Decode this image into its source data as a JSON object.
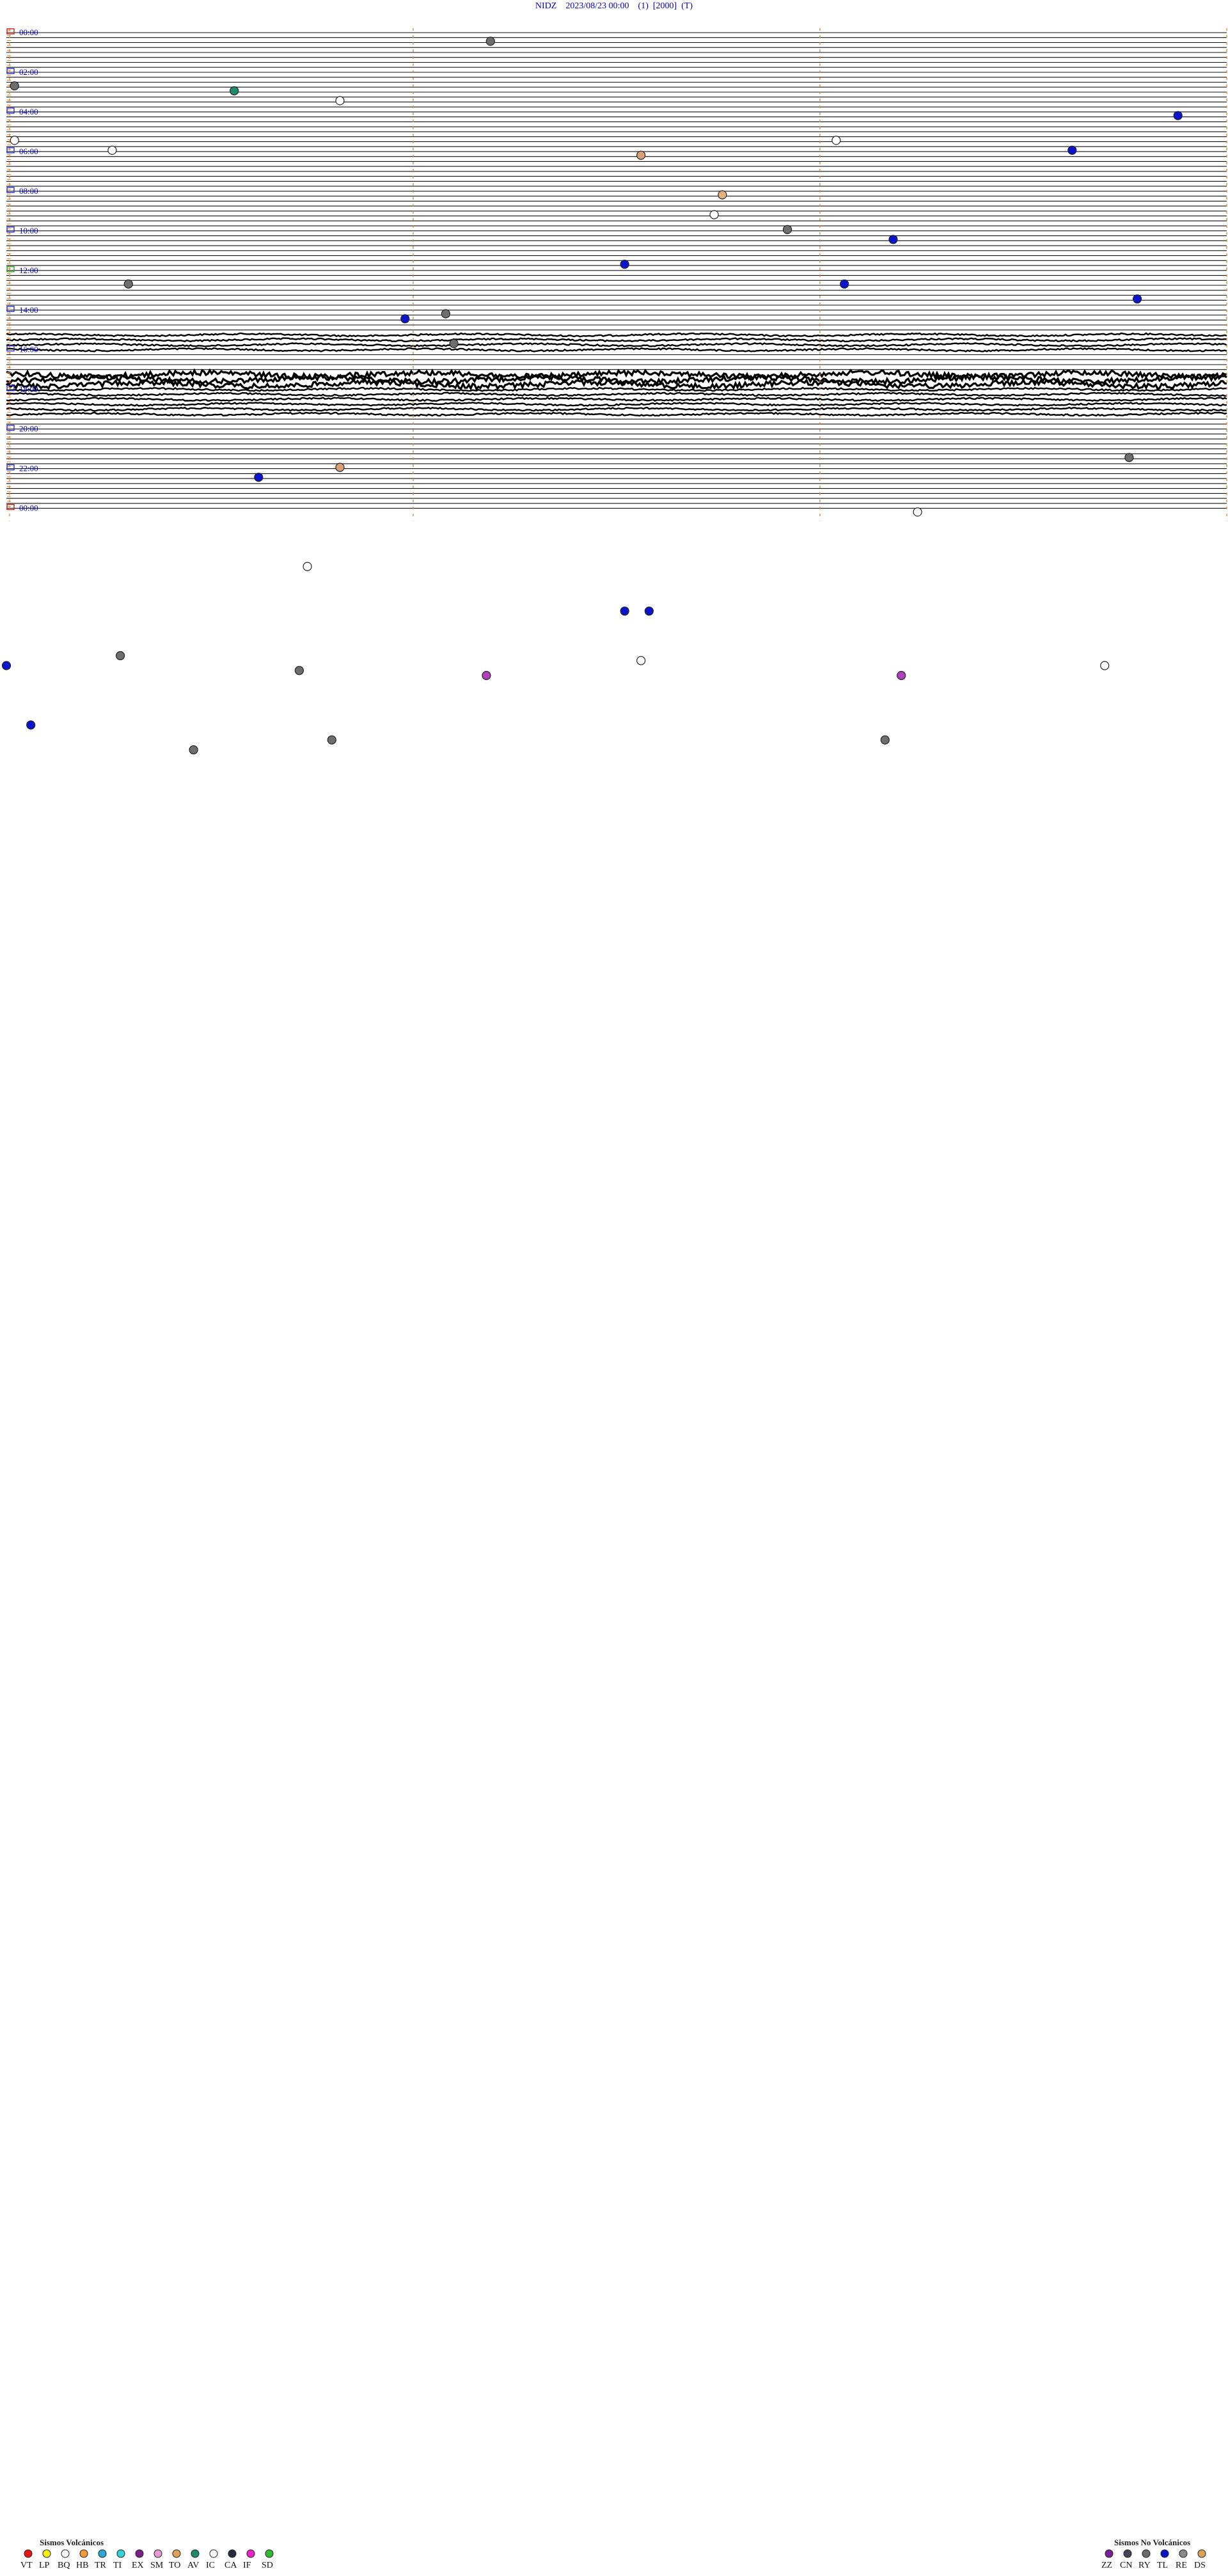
{
  "header": {
    "station": "NIDZ",
    "datetime": "2023/08/23 00:00",
    "field1": "(1)",
    "field2": "[2000]",
    "field3": "(T)"
  },
  "chart_data": {
    "type": "scatter",
    "lines_per_hour": 4,
    "hours": 24,
    "x_range": [
      0,
      15
    ],
    "x_unit": "minutes",
    "hour_labels": [
      "00:00",
      "02:00",
      "04:00",
      "06:00",
      "08:00",
      "10:00",
      "12:00",
      "14:00",
      "16:00",
      "18:00",
      "20:00",
      "22:00",
      "00:00"
    ],
    "busy_lines": [
      {
        "from": 61,
        "to": 64,
        "style": "wavy"
      },
      {
        "from": 69,
        "to": 71,
        "style": "band"
      },
      {
        "from": 72,
        "to": 77,
        "style": "wavy"
      }
    ],
    "events": [
      {
        "line": 2,
        "minute": 5.95,
        "type": "CA"
      },
      {
        "line": 11,
        "minute": 15.1,
        "type": "CA"
      },
      {
        "line": 12,
        "minute": 17.8,
        "type": "AV"
      },
      {
        "line": 14,
        "minute": 19.1,
        "type": "IC"
      },
      {
        "line": 17,
        "minute": 14.4,
        "type": "TL"
      },
      {
        "line": 22,
        "minute": 0.1,
        "type": "IC"
      },
      {
        "line": 22,
        "minute": 10.2,
        "type": "IC"
      },
      {
        "line": 24,
        "minute": 13.1,
        "type": "TL"
      },
      {
        "line": 24,
        "minute": 16.3,
        "type": "IC"
      },
      {
        "line": 25,
        "minute": 7.8,
        "type": "HB"
      },
      {
        "line": 33,
        "minute": 23.8,
        "type": "TO"
      },
      {
        "line": 37,
        "minute": 8.7,
        "type": "IC"
      },
      {
        "line": 40,
        "minute": 24.6,
        "type": "CA"
      },
      {
        "line": 42,
        "minute": 10.9,
        "type": "TL"
      },
      {
        "line": 47,
        "minute": 22.6,
        "type": "TL"
      },
      {
        "line": 51,
        "minute": 1.5,
        "type": "CA"
      },
      {
        "line": 51,
        "minute": 10.3,
        "type": "TL"
      },
      {
        "line": 54,
        "minute": 13.9,
        "type": "TL"
      },
      {
        "line": 57,
        "minute": 5.4,
        "type": "CA"
      },
      {
        "line": 58,
        "minute": 4.9,
        "type": "TL"
      },
      {
        "line": 63,
        "minute": 20.5,
        "type": "CA"
      },
      {
        "line": 86,
        "minute": 13.8,
        "type": "CA"
      },
      {
        "line": 88,
        "minute": 19.1,
        "type": "HB"
      },
      {
        "line": 90,
        "minute": 18.1,
        "type": "TL"
      },
      {
        "line": 97,
        "minute": 11.2,
        "type": "IC"
      },
      {
        "line": 108,
        "minute": 3.7,
        "type": "IC"
      },
      {
        "line": 117,
        "minute": 7.6,
        "type": "TL"
      },
      {
        "line": 117,
        "minute": 7.9,
        "type": "TL"
      },
      {
        "line": 126,
        "minute": 16.4,
        "type": "CA"
      },
      {
        "line": 127,
        "minute": 22.8,
        "type": "IC"
      },
      {
        "line": 128,
        "minute": 13.5,
        "type": "IC"
      },
      {
        "line": 128,
        "minute": 0.0,
        "type": "TL"
      },
      {
        "line": 129,
        "minute": 3.6,
        "type": "CA"
      },
      {
        "line": 130,
        "minute": 20.9,
        "type": "SM"
      },
      {
        "line": 130,
        "minute": 26.0,
        "type": "SM"
      },
      {
        "line": 140,
        "minute": 15.3,
        "type": "TL"
      },
      {
        "line": 143,
        "minute": 4.0,
        "type": "CA"
      },
      {
        "line": 143,
        "minute": 25.8,
        "type": "CA"
      },
      {
        "line": 145,
        "minute": 17.3,
        "type": "CA"
      }
    ]
  },
  "legend_volcanic": {
    "title": "Sismos Volcánicos",
    "codes": [
      "VT",
      "LP",
      "BQ",
      "HB",
      "TR",
      "TI",
      "EX",
      "SM",
      "TO",
      "AV",
      "IC",
      "CA",
      "IF",
      "SD"
    ],
    "colors": [
      "#e81515",
      "#f7f012",
      "#ffffff",
      "#f49a38",
      "#2aa9d9",
      "#2fd4dd",
      "#7a1f8a",
      "#e79ad9",
      "#d9a35a",
      "#1f8a6c",
      "#ffffff",
      "#2a2a3e",
      "#ee22cc",
      "#33bb33"
    ]
  },
  "legend_nonvolcanic": {
    "title": "Sismos No Volcánicos",
    "codes": [
      "ZZ",
      "CN",
      "RY",
      "TL",
      "RE",
      "DS"
    ],
    "colors": [
      "#7a1f9a",
      "#444455",
      "#6a6a6a",
      "#0a14cc",
      "#8a8a8a",
      "#d9a35a"
    ]
  },
  "event_colors": {
    "CA": "#6e6e6e",
    "AV": "#1f8a6c",
    "IC": "#ffffff",
    "TL": "#0a14cc",
    "HB": "#d9a078",
    "TO": "#e2b27a",
    "SM": "#b040c0"
  }
}
